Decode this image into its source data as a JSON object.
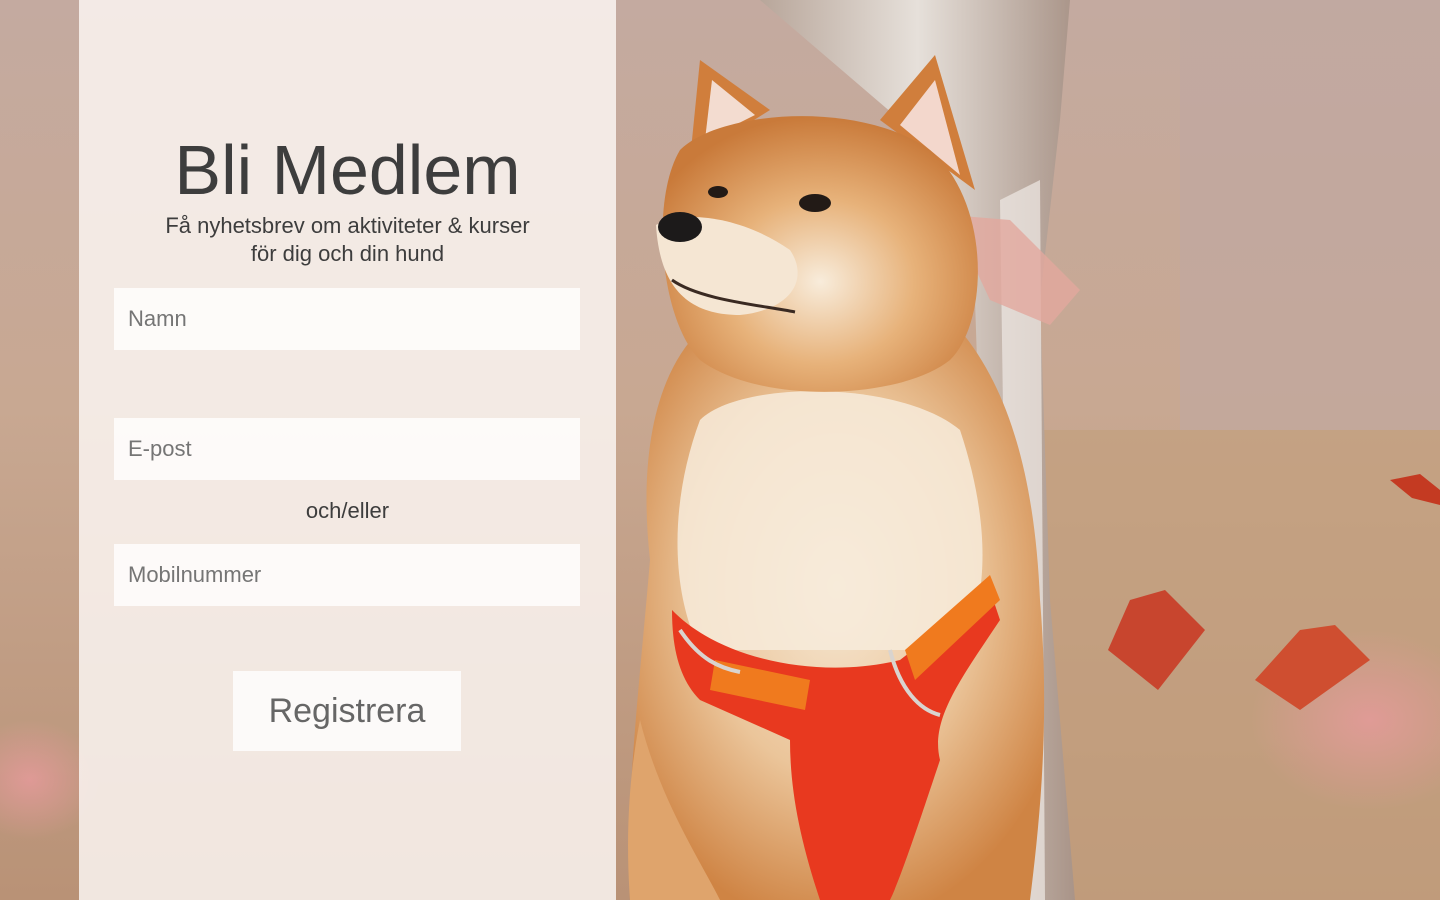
{
  "form": {
    "title": "Bli Medlem",
    "subtitle_line1": "Få nyhetsbrev om aktiviteter & kurser",
    "subtitle_line2": "för dig och din hund",
    "name_placeholder": "Namn",
    "email_placeholder": "E-post",
    "or_label": "och/eller",
    "phone_placeholder": "Mobilnummer",
    "submit_label": "Registrera"
  },
  "background": {
    "subject": "shiba-inu dog wearing red harness",
    "colors": {
      "fur": "#d68a45",
      "fur_light": "#f3e4cf",
      "harness": "#e8391f",
      "harness_strap": "#f07a1e",
      "leaves": "#c8452e"
    }
  }
}
